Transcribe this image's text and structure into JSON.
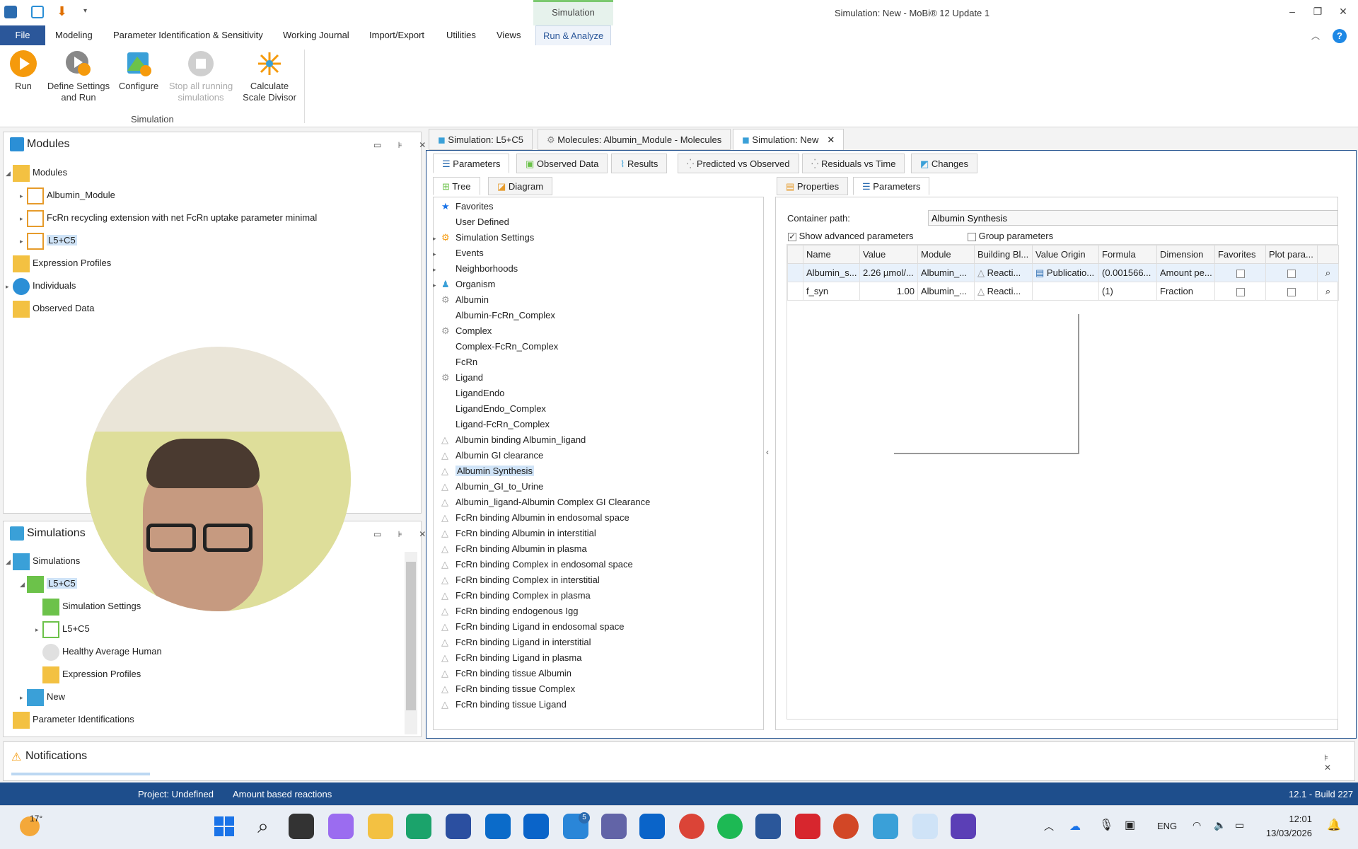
{
  "window": {
    "title": "Simulation: New - MoBi® 12 Update 1",
    "context_tab": "Simulation"
  },
  "menu": [
    "File",
    "Modeling",
    "Parameter Identification & Sensitivity",
    "Working Journal",
    "Import/Export",
    "Utilities",
    "Views",
    "Run & Analyze"
  ],
  "ribbon": {
    "buttons": [
      {
        "label": "Run"
      },
      {
        "label": "Define Settings and Run"
      },
      {
        "label": "Configure"
      },
      {
        "label": "Stop all running simulations"
      },
      {
        "label": "Calculate Scale Divisor"
      }
    ],
    "group": "Simulation"
  },
  "modules_panel": {
    "title": "Modules",
    "items": [
      "Modules",
      "Albumin_Module",
      "FcRn recycling extension with net FcRn uptake parameter minimal",
      "L5+C5",
      "Expression Profiles",
      "Individuals",
      "Observed Data"
    ]
  },
  "simulations_panel": {
    "title": "Simulations",
    "items": [
      "Simulations",
      "L5+C5",
      "Simulation Settings",
      "L5+C5",
      "Healthy Average Human",
      "Expression Profiles",
      "New",
      "Parameter Identifications"
    ]
  },
  "doc_tabs": [
    "Simulation: L5+C5",
    "Molecules: Albumin_Module - Molecules",
    "Simulation: New"
  ],
  "view_tabs": [
    "Parameters",
    "Observed Data",
    "Results",
    "Predicted vs Observed",
    "Residuals vs Time",
    "Changes"
  ],
  "left_tabs": [
    "Tree",
    "Diagram"
  ],
  "right_tabs": [
    "Properties",
    "Parameters"
  ],
  "tree": [
    "Favorites",
    "User Defined",
    "Simulation Settings",
    "Events",
    "Neighborhoods",
    "Organism",
    "Albumin",
    "Albumin-FcRn_Complex",
    "Complex",
    "Complex-FcRn_Complex",
    "FcRn",
    "Ligand",
    "LigandEndo",
    "LigandEndo_Complex",
    "Ligand-FcRn_Complex",
    "Albumin binding Albumin_ligand",
    "Albumin GI clearance",
    "Albumin Synthesis",
    "Albumin_GI_to_Urine",
    "Albumin_ligand-Albumin Complex GI Clearance",
    "FcRn binding Albumin in endosomal space",
    "FcRn binding Albumin in interstitial",
    "FcRn binding Albumin in plasma",
    "FcRn binding Complex in endosomal space",
    "FcRn binding Complex in interstitial",
    "FcRn binding Complex in plasma",
    "FcRn binding endogenous Igg",
    "FcRn binding Ligand in endosomal space",
    "FcRn binding Ligand in interstitial",
    "FcRn binding Ligand in plasma",
    "FcRn binding tissue Albumin",
    "FcRn binding tissue Complex",
    "FcRn binding tissue Ligand"
  ],
  "params": {
    "container_label": "Container path:",
    "container_value": "Albumin Synthesis",
    "show_advanced": "Show advanced parameters",
    "group_params": "Group parameters",
    "columns": [
      "Name",
      "Value",
      "Module",
      "Building Bl...",
      "Value Origin",
      "Formula",
      "Dimension",
      "Favorites",
      "Plot para..."
    ],
    "rows": [
      [
        "Albumin_s...",
        "2.26 µmol/...",
        "Albumin_...",
        "Reacti...",
        "Publicatio...",
        "(0.001566...",
        "Amount pe..."
      ],
      [
        "f_syn",
        "1.00",
        "Albumin_...",
        "Reacti...",
        "",
        "(1)",
        "Fraction"
      ]
    ]
  },
  "notifications": {
    "title": "Notifications"
  },
  "status": {
    "project": "Project: Undefined",
    "mode": "Amount based reactions",
    "build": "12.1 - Build 227"
  },
  "taskbar": {
    "weather": "17°",
    "lang": "ENG",
    "time": "12:01",
    "date": "13/03/2026",
    "badge1": "5"
  }
}
